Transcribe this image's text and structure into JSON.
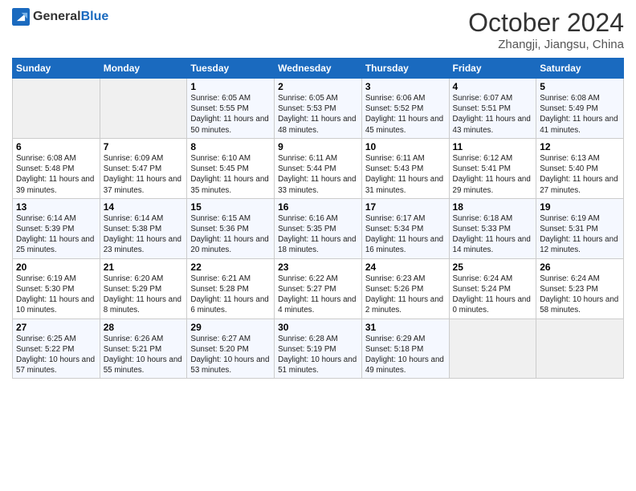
{
  "header": {
    "logo_general": "General",
    "logo_blue": "Blue",
    "title": "October 2024",
    "subtitle": "Zhangji, Jiangsu, China"
  },
  "calendar": {
    "weekdays": [
      "Sunday",
      "Monday",
      "Tuesday",
      "Wednesday",
      "Thursday",
      "Friday",
      "Saturday"
    ],
    "weeks": [
      [
        {
          "day": "",
          "info": ""
        },
        {
          "day": "",
          "info": ""
        },
        {
          "day": "1",
          "info": "Sunrise: 6:05 AM\nSunset: 5:55 PM\nDaylight: 11 hours and 50 minutes."
        },
        {
          "day": "2",
          "info": "Sunrise: 6:05 AM\nSunset: 5:53 PM\nDaylight: 11 hours and 48 minutes."
        },
        {
          "day": "3",
          "info": "Sunrise: 6:06 AM\nSunset: 5:52 PM\nDaylight: 11 hours and 45 minutes."
        },
        {
          "day": "4",
          "info": "Sunrise: 6:07 AM\nSunset: 5:51 PM\nDaylight: 11 hours and 43 minutes."
        },
        {
          "day": "5",
          "info": "Sunrise: 6:08 AM\nSunset: 5:49 PM\nDaylight: 11 hours and 41 minutes."
        }
      ],
      [
        {
          "day": "6",
          "info": "Sunrise: 6:08 AM\nSunset: 5:48 PM\nDaylight: 11 hours and 39 minutes."
        },
        {
          "day": "7",
          "info": "Sunrise: 6:09 AM\nSunset: 5:47 PM\nDaylight: 11 hours and 37 minutes."
        },
        {
          "day": "8",
          "info": "Sunrise: 6:10 AM\nSunset: 5:45 PM\nDaylight: 11 hours and 35 minutes."
        },
        {
          "day": "9",
          "info": "Sunrise: 6:11 AM\nSunset: 5:44 PM\nDaylight: 11 hours and 33 minutes."
        },
        {
          "day": "10",
          "info": "Sunrise: 6:11 AM\nSunset: 5:43 PM\nDaylight: 11 hours and 31 minutes."
        },
        {
          "day": "11",
          "info": "Sunrise: 6:12 AM\nSunset: 5:41 PM\nDaylight: 11 hours and 29 minutes."
        },
        {
          "day": "12",
          "info": "Sunrise: 6:13 AM\nSunset: 5:40 PM\nDaylight: 11 hours and 27 minutes."
        }
      ],
      [
        {
          "day": "13",
          "info": "Sunrise: 6:14 AM\nSunset: 5:39 PM\nDaylight: 11 hours and 25 minutes."
        },
        {
          "day": "14",
          "info": "Sunrise: 6:14 AM\nSunset: 5:38 PM\nDaylight: 11 hours and 23 minutes."
        },
        {
          "day": "15",
          "info": "Sunrise: 6:15 AM\nSunset: 5:36 PM\nDaylight: 11 hours and 20 minutes."
        },
        {
          "day": "16",
          "info": "Sunrise: 6:16 AM\nSunset: 5:35 PM\nDaylight: 11 hours and 18 minutes."
        },
        {
          "day": "17",
          "info": "Sunrise: 6:17 AM\nSunset: 5:34 PM\nDaylight: 11 hours and 16 minutes."
        },
        {
          "day": "18",
          "info": "Sunrise: 6:18 AM\nSunset: 5:33 PM\nDaylight: 11 hours and 14 minutes."
        },
        {
          "day": "19",
          "info": "Sunrise: 6:19 AM\nSunset: 5:31 PM\nDaylight: 11 hours and 12 minutes."
        }
      ],
      [
        {
          "day": "20",
          "info": "Sunrise: 6:19 AM\nSunset: 5:30 PM\nDaylight: 11 hours and 10 minutes."
        },
        {
          "day": "21",
          "info": "Sunrise: 6:20 AM\nSunset: 5:29 PM\nDaylight: 11 hours and 8 minutes."
        },
        {
          "day": "22",
          "info": "Sunrise: 6:21 AM\nSunset: 5:28 PM\nDaylight: 11 hours and 6 minutes."
        },
        {
          "day": "23",
          "info": "Sunrise: 6:22 AM\nSunset: 5:27 PM\nDaylight: 11 hours and 4 minutes."
        },
        {
          "day": "24",
          "info": "Sunrise: 6:23 AM\nSunset: 5:26 PM\nDaylight: 11 hours and 2 minutes."
        },
        {
          "day": "25",
          "info": "Sunrise: 6:24 AM\nSunset: 5:24 PM\nDaylight: 11 hours and 0 minutes."
        },
        {
          "day": "26",
          "info": "Sunrise: 6:24 AM\nSunset: 5:23 PM\nDaylight: 10 hours and 58 minutes."
        }
      ],
      [
        {
          "day": "27",
          "info": "Sunrise: 6:25 AM\nSunset: 5:22 PM\nDaylight: 10 hours and 57 minutes."
        },
        {
          "day": "28",
          "info": "Sunrise: 6:26 AM\nSunset: 5:21 PM\nDaylight: 10 hours and 55 minutes."
        },
        {
          "day": "29",
          "info": "Sunrise: 6:27 AM\nSunset: 5:20 PM\nDaylight: 10 hours and 53 minutes."
        },
        {
          "day": "30",
          "info": "Sunrise: 6:28 AM\nSunset: 5:19 PM\nDaylight: 10 hours and 51 minutes."
        },
        {
          "day": "31",
          "info": "Sunrise: 6:29 AM\nSunset: 5:18 PM\nDaylight: 10 hours and 49 minutes."
        },
        {
          "day": "",
          "info": ""
        },
        {
          "day": "",
          "info": ""
        }
      ]
    ]
  }
}
